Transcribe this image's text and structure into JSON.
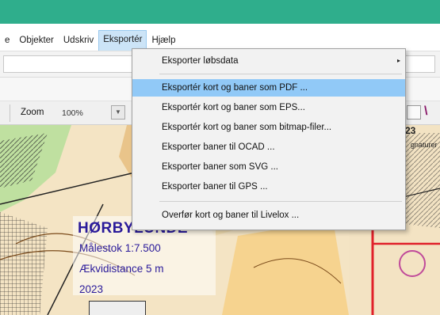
{
  "menubar": {
    "items": [
      {
        "label": "e"
      },
      {
        "label": "Objekter"
      },
      {
        "label": "Udskriv"
      },
      {
        "label": "Eksportér"
      },
      {
        "label": "Hjælp"
      }
    ]
  },
  "toolbar": {
    "zoom_label": "Zoom",
    "zoom_value": "100%"
  },
  "export_menu": {
    "items": [
      {
        "label": "Eksporter løbsdata",
        "has_submenu": true
      },
      {
        "label": "Eksportér kort og baner som PDF ...",
        "highlighted": true
      },
      {
        "label": "Eksportér kort og baner som EPS..."
      },
      {
        "label": "Eksportér kort og baner som bitmap-filer..."
      },
      {
        "label": "Eksporter baner til OCAD ..."
      },
      {
        "label": "Eksporter baner som SVG ..."
      },
      {
        "label": "Eksporter baner til GPS ..."
      },
      {
        "label": "Overfør kort og baner til Livelox ..."
      }
    ],
    "submenu_arrow": "▸"
  },
  "map": {
    "title": "HØRBYLUNDE",
    "scale": "Målestok 1:7.500",
    "contour": "Ækvidistance 5 m",
    "year": "2023",
    "year_top": "23",
    "side_text": "gnaturer"
  },
  "colors": {
    "titlebar": "#2fae8c",
    "menu_highlight": "#91c9f7",
    "map_text": "#2a1a9a",
    "course_line": "#e0202a"
  }
}
